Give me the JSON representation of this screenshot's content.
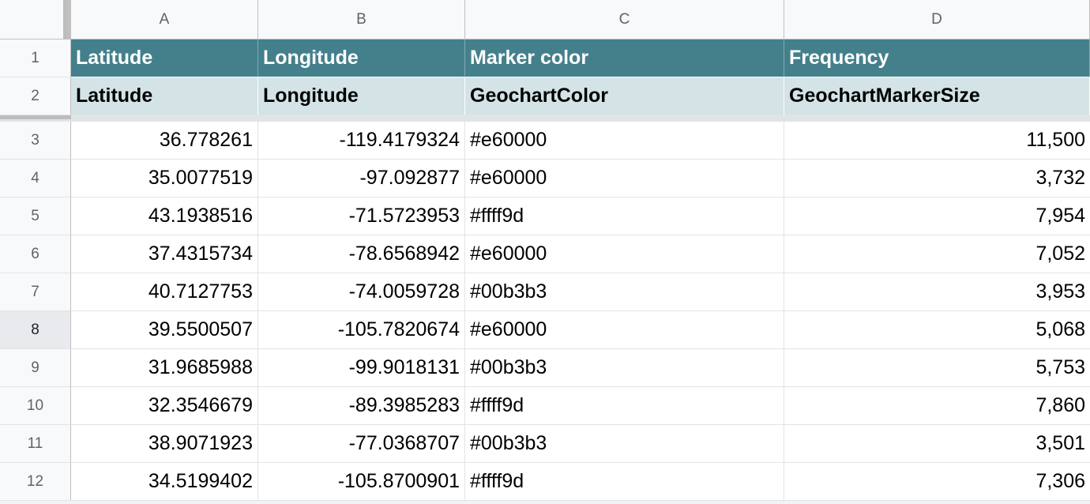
{
  "columns": [
    "A",
    "B",
    "C",
    "D"
  ],
  "header_row_1": {
    "row_number": "1",
    "cells": [
      "Latitude",
      "Longitude",
      "Marker color",
      "Frequency"
    ]
  },
  "header_row_2": {
    "row_number": "2",
    "cells": [
      "Latitude",
      "Longitude",
      "GeochartColor",
      "GeochartMarkerSize"
    ]
  },
  "header_colors": {
    "row1_background": "#44808c",
    "row2_background": "#d3e3e6"
  },
  "selected_row": "8",
  "rows": [
    {
      "num": "3",
      "lat": "36.778261",
      "lng": "-119.4179324",
      "color": "#e60000",
      "freq": "11,500"
    },
    {
      "num": "4",
      "lat": "35.0077519",
      "lng": "-97.092877",
      "color": "#e60000",
      "freq": "3,732"
    },
    {
      "num": "5",
      "lat": "43.1938516",
      "lng": "-71.5723953",
      "color": "#ffff9d",
      "freq": "7,954"
    },
    {
      "num": "6",
      "lat": "37.4315734",
      "lng": "-78.6568942",
      "color": "#e60000",
      "freq": "7,052"
    },
    {
      "num": "7",
      "lat": "40.7127753",
      "lng": "-74.0059728",
      "color": "#00b3b3",
      "freq": "3,953"
    },
    {
      "num": "8",
      "lat": "39.5500507",
      "lng": "-105.7820674",
      "color": "#e60000",
      "freq": "5,068"
    },
    {
      "num": "9",
      "lat": "31.9685988",
      "lng": "-99.9018131",
      "color": "#00b3b3",
      "freq": "5,753"
    },
    {
      "num": "10",
      "lat": "32.3546679",
      "lng": "-89.3985283",
      "color": "#ffff9d",
      "freq": "7,860"
    },
    {
      "num": "11",
      "lat": "38.9071923",
      "lng": "-77.0368707",
      "color": "#00b3b3",
      "freq": "3,501"
    },
    {
      "num": "12",
      "lat": "34.5199402",
      "lng": "-105.8700901",
      "color": "#ffff9d",
      "freq": "7,306"
    }
  ]
}
